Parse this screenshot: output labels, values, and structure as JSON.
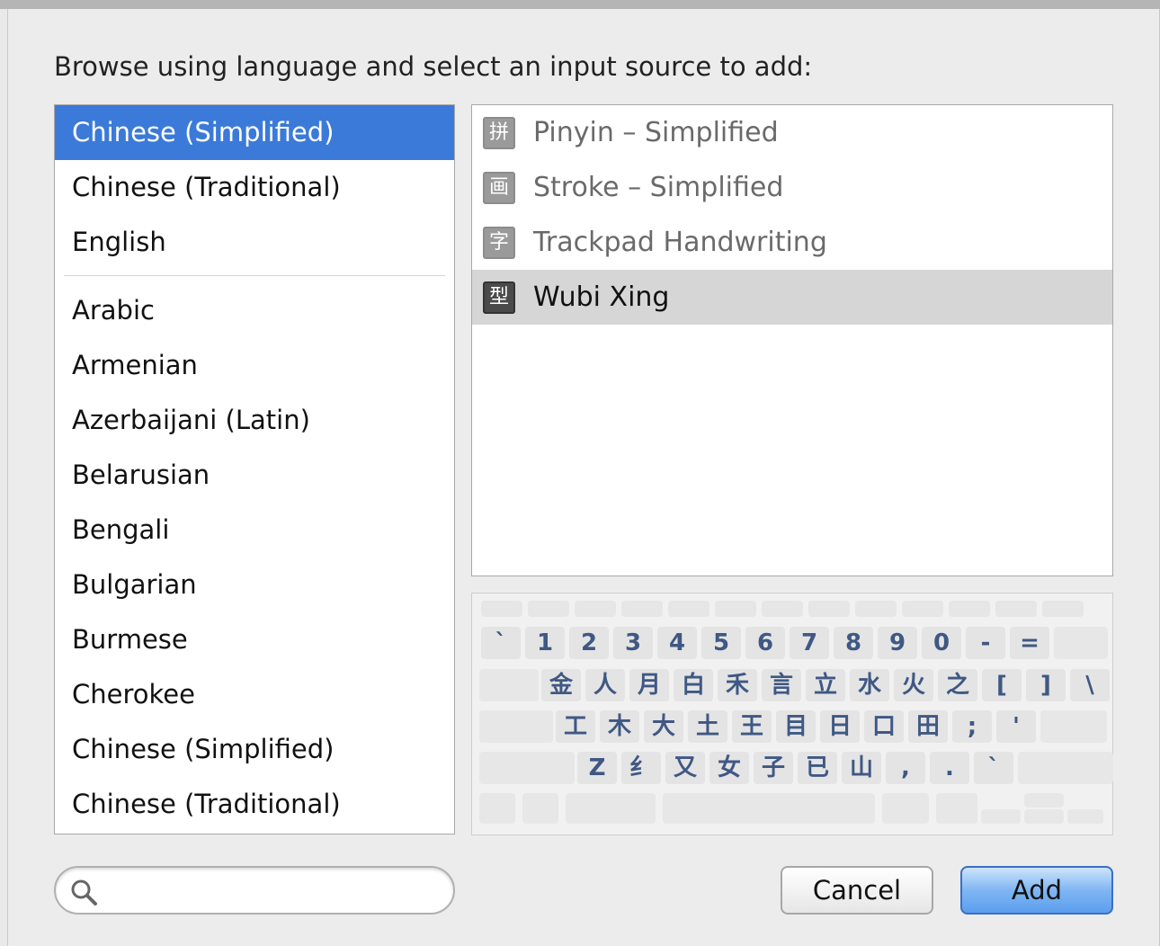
{
  "dialog": {
    "instruction": "Browse using language and select an input source to add:"
  },
  "languages": {
    "top": [
      "Chinese (Simplified)",
      "Chinese (Traditional)",
      "English"
    ],
    "all": [
      "Arabic",
      "Armenian",
      "Azerbaijani (Latin)",
      "Belarusian",
      "Bengali",
      "Bulgarian",
      "Burmese",
      "Cherokee",
      "Chinese (Simplified)",
      "Chinese (Traditional)"
    ],
    "selected": "Chinese (Simplified)"
  },
  "input_sources": {
    "items": [
      {
        "label": "Pinyin – Simplified",
        "icon": "拼",
        "icon_name": "pinyin-icon"
      },
      {
        "label": "Stroke – Simplified",
        "icon": "画",
        "icon_name": "stroke-icon"
      },
      {
        "label": "Trackpad Handwriting",
        "icon": "字",
        "icon_name": "handwriting-icon"
      },
      {
        "label": "Wubi Xing",
        "icon": "型",
        "icon_name": "wubi-icon"
      }
    ],
    "selected": "Wubi Xing"
  },
  "keyboard": {
    "row1": [
      "`",
      "1",
      "2",
      "3",
      "4",
      "5",
      "6",
      "7",
      "8",
      "9",
      "0",
      "-",
      "="
    ],
    "row2": [
      "金",
      "人",
      "月",
      "白",
      "禾",
      "言",
      "立",
      "水",
      "火",
      "之",
      "[",
      "]",
      "\\"
    ],
    "row3": [
      "工",
      "木",
      "大",
      "土",
      "王",
      "目",
      "日",
      "口",
      "田",
      ";",
      "'"
    ],
    "row4": [
      "Z",
      "纟",
      "又",
      "女",
      "子",
      "已",
      "山",
      ",",
      ".",
      "`"
    ]
  },
  "search": {
    "placeholder": "",
    "value": ""
  },
  "buttons": {
    "cancel": "Cancel",
    "add": "Add"
  },
  "colors": {
    "selection": "#3b7ad9",
    "key_text": "#3f5884",
    "add_button": "#7fb6f2"
  }
}
